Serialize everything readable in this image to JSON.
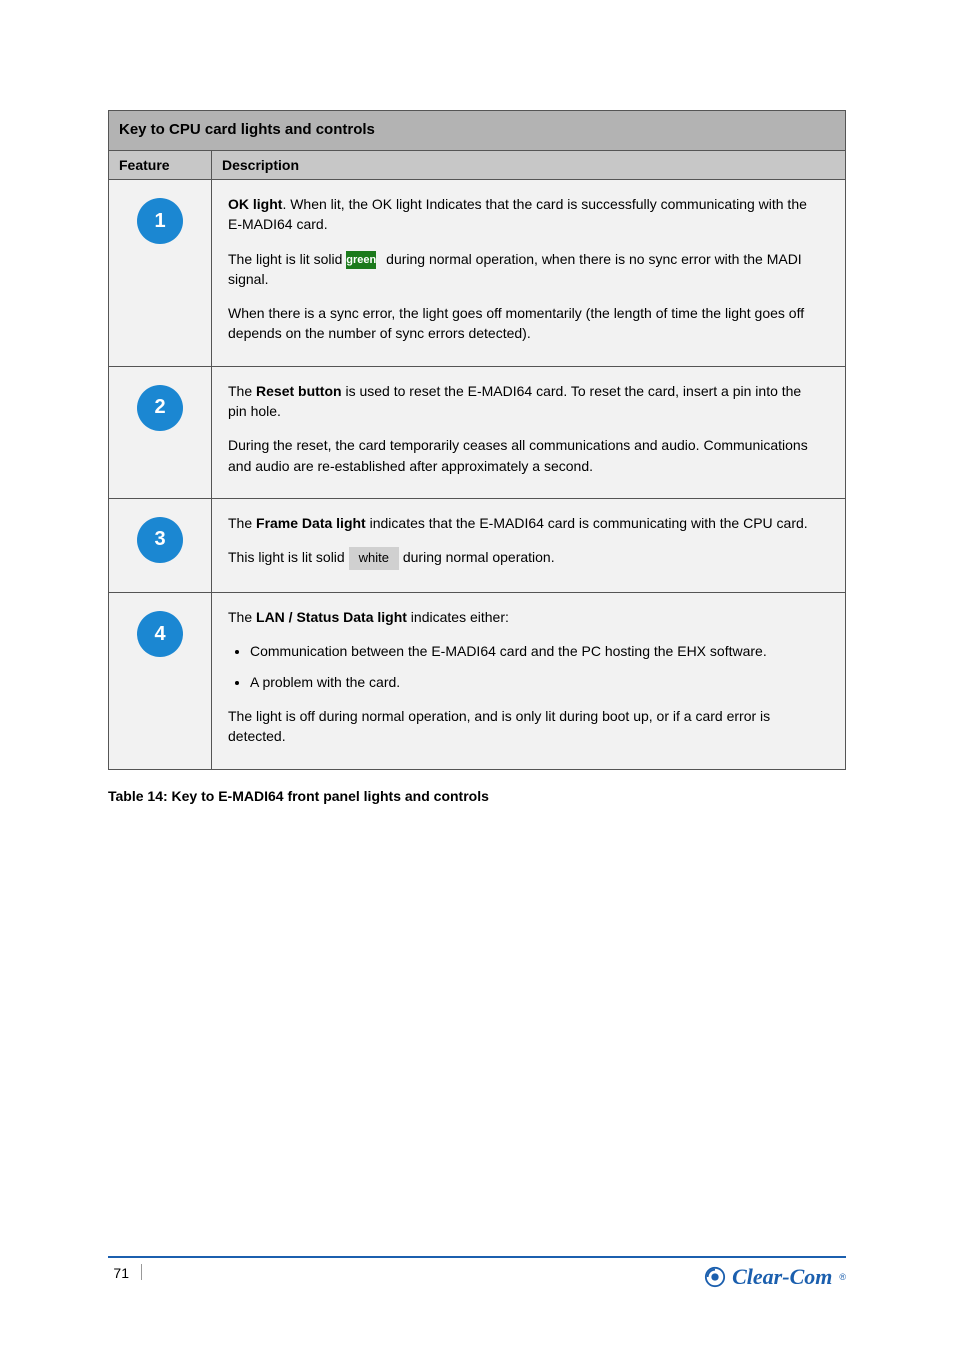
{
  "table": {
    "title": "Key to CPU card lights and controls",
    "headers": {
      "feature": "Feature",
      "description": "Description"
    },
    "rows": [
      {
        "num": "1",
        "lead": "OK light",
        "leadAfter": ". When lit, the OK light Indicates that the card is successfully communicating with the",
        "line2": "E-MADI64 card.",
        "line3Before": "The light is lit solid",
        "green": "green",
        "line3After": " during normal operation, when there is no sync error with the MADI signal.",
        "line4": "When there is a sync error, the light goes off momentarily (the length of time the light goes off depends on the number of sync errors detected)."
      },
      {
        "num": "2",
        "leadPrefix": "The ",
        "lead": "Reset button",
        "leadAfter": " is used to reset the E-MADI64 card. To reset the card, insert a pin into the",
        "line2": "pin hole.",
        "line3": "During the reset, the card temporarily  ceases all communications and audio. Communications and audio are re-established after approximately a second."
      },
      {
        "num": "3",
        "leadPrefix": "The ",
        "lead": "Frame Data light",
        "leadAfter": " indicates that the E-MADI64 card is communicating with the CPU card.",
        "line2Before": "This light is lit solid ",
        "gray": "white",
        "line2After": " during normal operation."
      },
      {
        "num": "4",
        "leadPrefix": "The ",
        "lead": "LAN / Status Data light",
        "leadAfter": " indicates either:",
        "bullets": [
          "Communication between the E-MADI64 card and the PC hosting the EHX software.",
          "A problem with the card."
        ],
        "line3": "The light is off during normal operation, and is only lit during boot up, or if a card error is detected."
      }
    ]
  },
  "caption": "Table 14: Key to E-MADI64 front panel lights and controls",
  "footer": {
    "page": "71",
    "brand": "Clear-Com"
  }
}
